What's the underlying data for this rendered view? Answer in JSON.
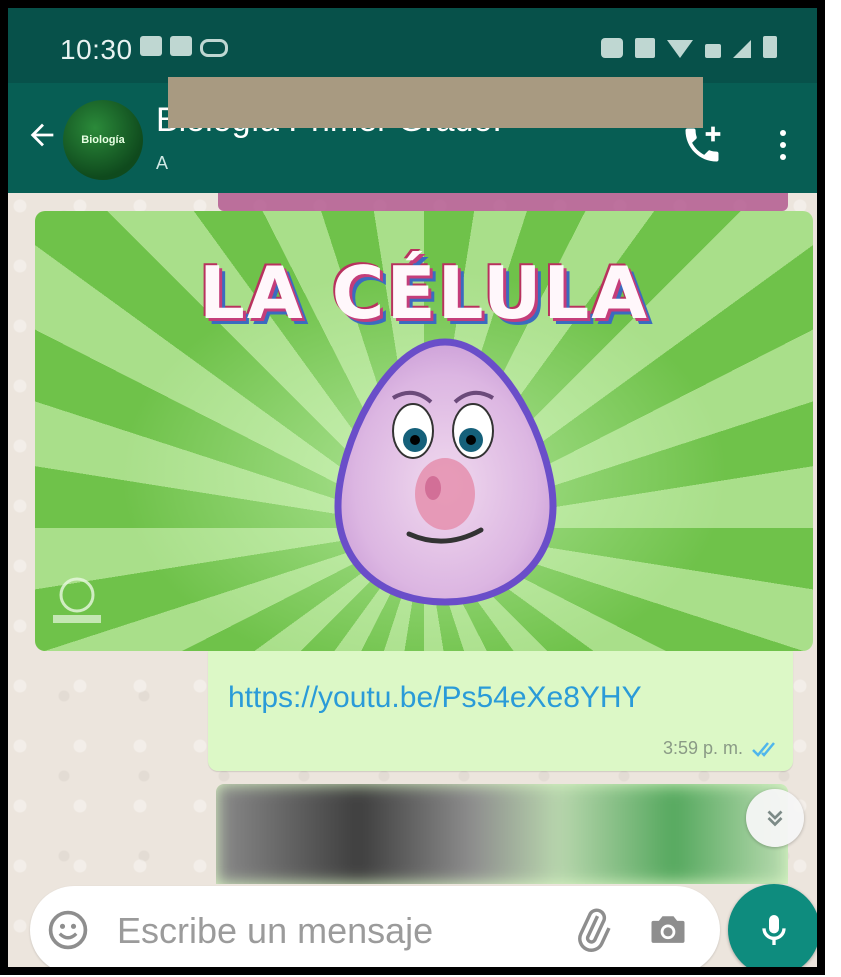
{
  "status_bar": {
    "time": "10:30",
    "notification_icons": [
      "message-icon",
      "cast-icon",
      "voicemail-icon"
    ],
    "system_icons": [
      "alarm-icon",
      "mute-icon",
      "wifi-icon",
      "data-icon",
      "signal-icon",
      "battery-icon"
    ]
  },
  "toolbar": {
    "avatar_text": "Biología",
    "title": "Biología Primer Grado.",
    "subtitle": "A",
    "background_color": "#075e54"
  },
  "media_message": {
    "thumbnail_title": "LA CÉLULA"
  },
  "link_message": {
    "url": "https://youtu.be/Ps54eXe8YHY",
    "time": "3:59 p. m.",
    "status": "read"
  },
  "composer": {
    "placeholder": "Escribe un mensaje"
  },
  "colors": {
    "accent": "#0e8c7e",
    "link": "#2a9bd8",
    "outgoing_bubble": "#dcf8c6",
    "redaction": "#a89a81"
  }
}
